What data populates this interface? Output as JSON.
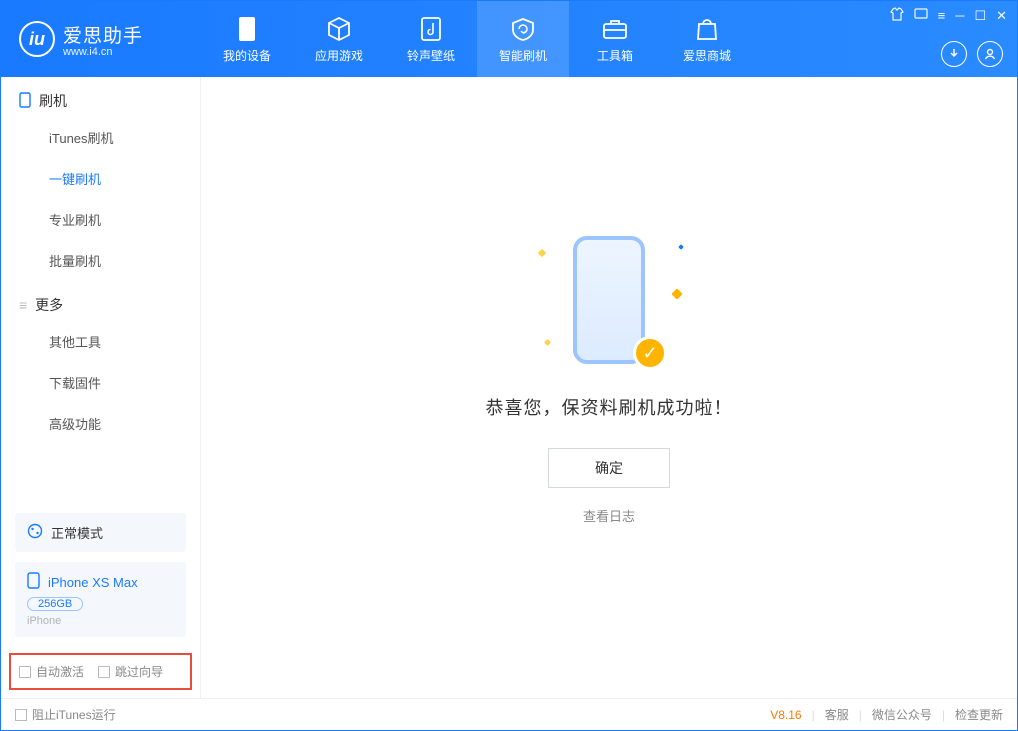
{
  "app": {
    "title": "爱思助手",
    "url": "www.i4.cn",
    "logo_glyph": "iu"
  },
  "nav": {
    "items": [
      {
        "label": "我的设备",
        "icon": "device-icon"
      },
      {
        "label": "应用游戏",
        "icon": "cube-icon"
      },
      {
        "label": "铃声壁纸",
        "icon": "music-icon"
      },
      {
        "label": "智能刷机",
        "icon": "refresh-icon",
        "active": true
      },
      {
        "label": "工具箱",
        "icon": "toolbox-icon"
      },
      {
        "label": "爱思商城",
        "icon": "bag-icon"
      }
    ]
  },
  "sidebar": {
    "section1_title": "刷机",
    "section1_items": [
      {
        "label": "iTunes刷机"
      },
      {
        "label": "一键刷机",
        "active": true
      },
      {
        "label": "专业刷机"
      },
      {
        "label": "批量刷机"
      }
    ],
    "section2_title": "更多",
    "section2_items": [
      {
        "label": "其他工具"
      },
      {
        "label": "下载固件"
      },
      {
        "label": "高级功能"
      }
    ],
    "mode_label": "正常模式",
    "device": {
      "name": "iPhone XS Max",
      "storage": "256GB",
      "type": "iPhone"
    },
    "options": {
      "auto_activate_label": "自动激活",
      "skip_wizard_label": "跳过向导"
    }
  },
  "main": {
    "success_message": "恭喜您，保资料刷机成功啦！",
    "ok_button": "确定",
    "view_log": "查看日志"
  },
  "footer": {
    "block_itunes_label": "阻止iTunes运行",
    "version": "V8.16",
    "links": [
      "客服",
      "微信公众号",
      "检查更新"
    ]
  },
  "colors": {
    "primary": "#1a7aff",
    "accent": "#ffb400",
    "highlight_border": "#e74c3c"
  }
}
